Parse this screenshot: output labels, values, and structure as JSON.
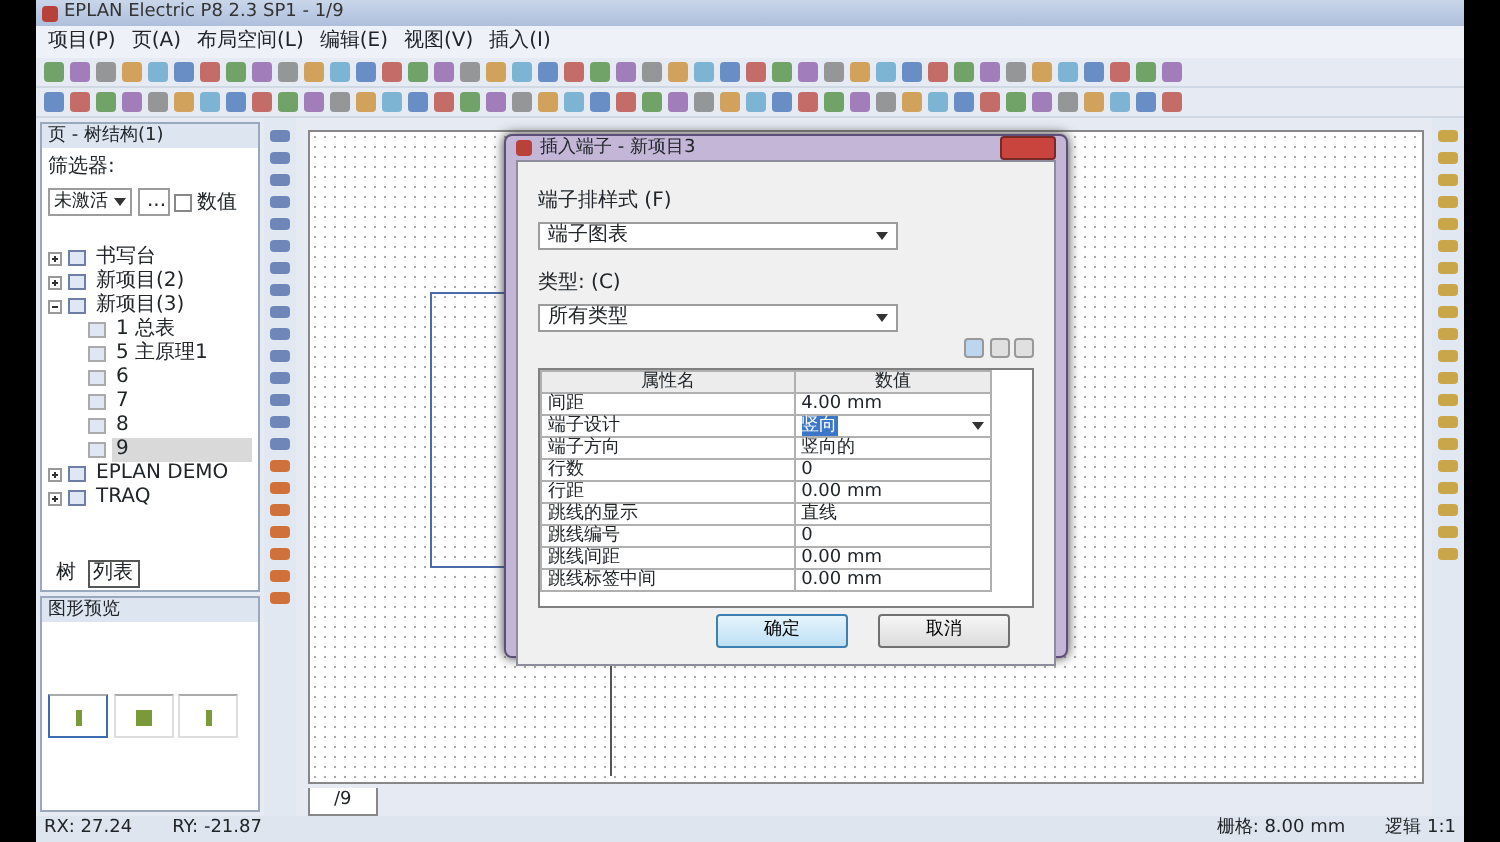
{
  "window": {
    "title": "EPLAN Electric P8 2.3 SP1 - 1/9"
  },
  "menu": [
    "项目(P)",
    "页(A)",
    "布局空间(L)",
    "编辑(E)",
    "视图(V)",
    "插入(I)"
  ],
  "tree_panel": {
    "title": "页 - 树结构(1)",
    "filter_label": "筛选器:",
    "filter_value": "未激活",
    "more_button": "...",
    "value_checkbox": {
      "label": "数值",
      "checked": false
    },
    "items": [
      {
        "label": "书写台",
        "expanded": false,
        "selected": false
      },
      {
        "label": "新项目(2)",
        "expanded": false,
        "selected": false
      },
      {
        "label": "新项目(3)",
        "expanded": true,
        "selected": false,
        "children": [
          {
            "label": "1 总表",
            "selected": false
          },
          {
            "label": "5 主原理1",
            "selected": false
          },
          {
            "label": "6",
            "selected": false
          },
          {
            "label": "7",
            "selected": false
          },
          {
            "label": "8",
            "selected": false
          },
          {
            "label": "9",
            "selected": true
          }
        ]
      },
      {
        "label": "EPLAN DEMO",
        "expanded": false,
        "selected": false
      },
      {
        "label": "TRAQ",
        "expanded": false,
        "selected": false
      }
    ],
    "tabs": [
      {
        "label": "树",
        "selected": false
      },
      {
        "label": "列表",
        "selected": true
      }
    ]
  },
  "preview_panel": {
    "title": "图形预览"
  },
  "page_tab": "/9",
  "dialog": {
    "title": "插入端子 - 新项目3",
    "style_label": "端子排样式 (F)",
    "style_value": "端子图表",
    "type_label": "类型: (C)",
    "type_value": "所有类型",
    "columns": [
      "属性名",
      "数值"
    ],
    "rows": [
      {
        "name": "间距",
        "value": "4.00 mm",
        "kind": "text"
      },
      {
        "name": "端子设计",
        "value": "竖向",
        "kind": "select"
      },
      {
        "name": "端子方向",
        "value": "竖向的",
        "kind": "text"
      },
      {
        "name": "行数",
        "value": "0",
        "kind": "text"
      },
      {
        "name": "行距",
        "value": "0.00 mm",
        "kind": "text"
      },
      {
        "name": "跳线的显示",
        "value": "直线",
        "kind": "text"
      },
      {
        "name": "跳线编号",
        "value": "0",
        "kind": "text"
      },
      {
        "name": "跳线间距",
        "value": "0.00 mm",
        "kind": "text"
      },
      {
        "name": "跳线标签中间",
        "value": "0.00 mm",
        "kind": "text"
      }
    ],
    "ok": "确定",
    "cancel": "取消"
  },
  "status_bar": {
    "rx": "RX: 27.24",
    "ry": "RY: -21.87",
    "grid": "栅格: 8.00 mm",
    "scale": "逻辑 1:1"
  }
}
